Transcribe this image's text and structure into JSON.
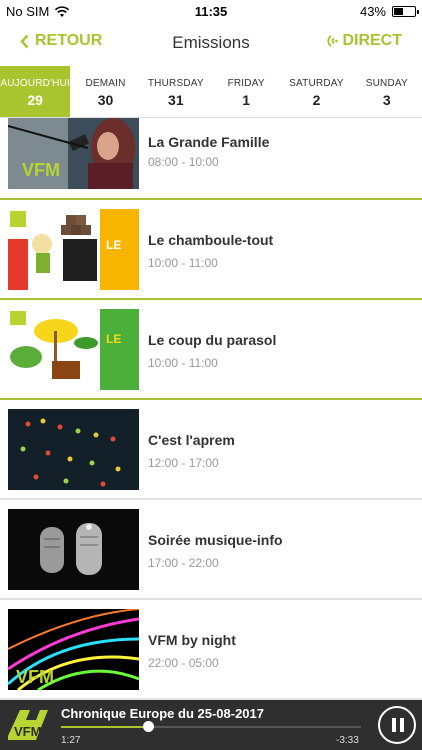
{
  "status_bar": {
    "carrier": "No SIM",
    "time": "11:35",
    "battery": "43%",
    "battery_level": 0.43
  },
  "nav": {
    "back_label": "RETOUR",
    "title": "Emissions",
    "direct_label": "DIRECT"
  },
  "day_tabs": [
    {
      "name": "AUJOURD'HUI",
      "num": "29",
      "active": true
    },
    {
      "name": "DEMAIN",
      "num": "30",
      "active": false
    },
    {
      "name": "THURSDAY",
      "num": "31",
      "active": false
    },
    {
      "name": "FRIDAY",
      "num": "1",
      "active": false
    },
    {
      "name": "SATURDAY",
      "num": "2",
      "active": false
    },
    {
      "name": "SUNDAY",
      "num": "3",
      "active": false
    }
  ],
  "shows": [
    {
      "title": "La Grande Famille",
      "time": "08:00 - 10:00"
    },
    {
      "title": "Le chamboule-tout",
      "time": "10:00 - 11:00"
    },
    {
      "title": "Le coup du parasol",
      "time": "10:00 - 11:00"
    },
    {
      "title": "C'est l'aprem",
      "time": "12:00 - 17:00"
    },
    {
      "title": "Soirée musique-info",
      "time": "17:00 - 22:00"
    },
    {
      "title": "VFM by night",
      "time": "22:00 - 05:00"
    }
  ],
  "player": {
    "title": "Chronique Europe du 25-08-2017",
    "elapsed": "1:27",
    "remaining": "-3:33",
    "progress": 0.29,
    "logo_text": "VFM"
  },
  "colors": {
    "accent": "#a8c52f",
    "player_bg": "#2f2f2f"
  }
}
